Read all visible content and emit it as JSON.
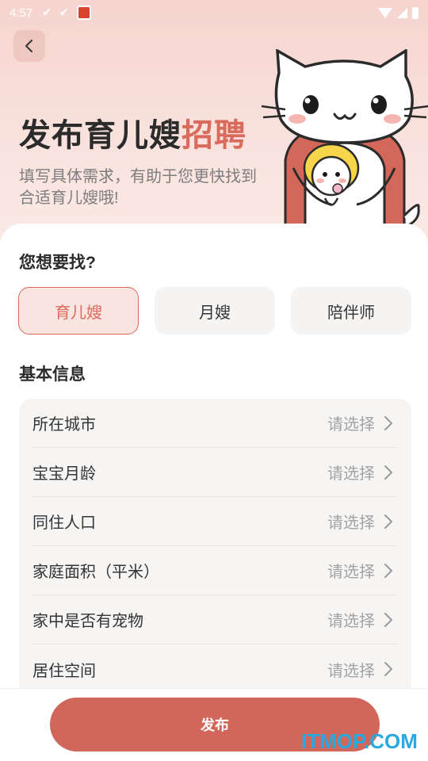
{
  "status_bar": {
    "time": "4:57",
    "left_icons": [
      "check-icon",
      "check-icon",
      "app-icon"
    ],
    "right_icons": [
      "wifi-icon",
      "signal-icon",
      "battery-icon"
    ]
  },
  "header": {
    "back_icon": "chevron-left-icon",
    "title_main": "发布育儿嫂",
    "title_accent": "招聘",
    "subtitle": "填写具体需求，有助于您更快找到合适育儿嫂哦!",
    "mascot": "cat-mascot"
  },
  "colors": {
    "accent": "#d96a5c",
    "button": "#d0675a",
    "hero_bg": "#f6d4cf",
    "watermark": "#2aa8e0"
  },
  "looking_for": {
    "title": "您想要找?",
    "options": [
      {
        "label": "育儿嫂",
        "selected": true
      },
      {
        "label": "月嫂",
        "selected": false
      },
      {
        "label": "陪伴师",
        "selected": false
      }
    ]
  },
  "basic_info": {
    "title": "基本信息",
    "rows": [
      {
        "label": "所在城市",
        "value": "请选择"
      },
      {
        "label": "宝宝月龄",
        "value": "请选择"
      },
      {
        "label": "同住人口",
        "value": "请选择"
      },
      {
        "label": "家庭面积（平米）",
        "value": "请选择"
      },
      {
        "label": "家中是否有宠物",
        "value": "请选择"
      },
      {
        "label": "居住空间",
        "value": "请选择"
      }
    ]
  },
  "footer": {
    "publish_label": "发布"
  },
  "watermark": "ITMOP.COM"
}
